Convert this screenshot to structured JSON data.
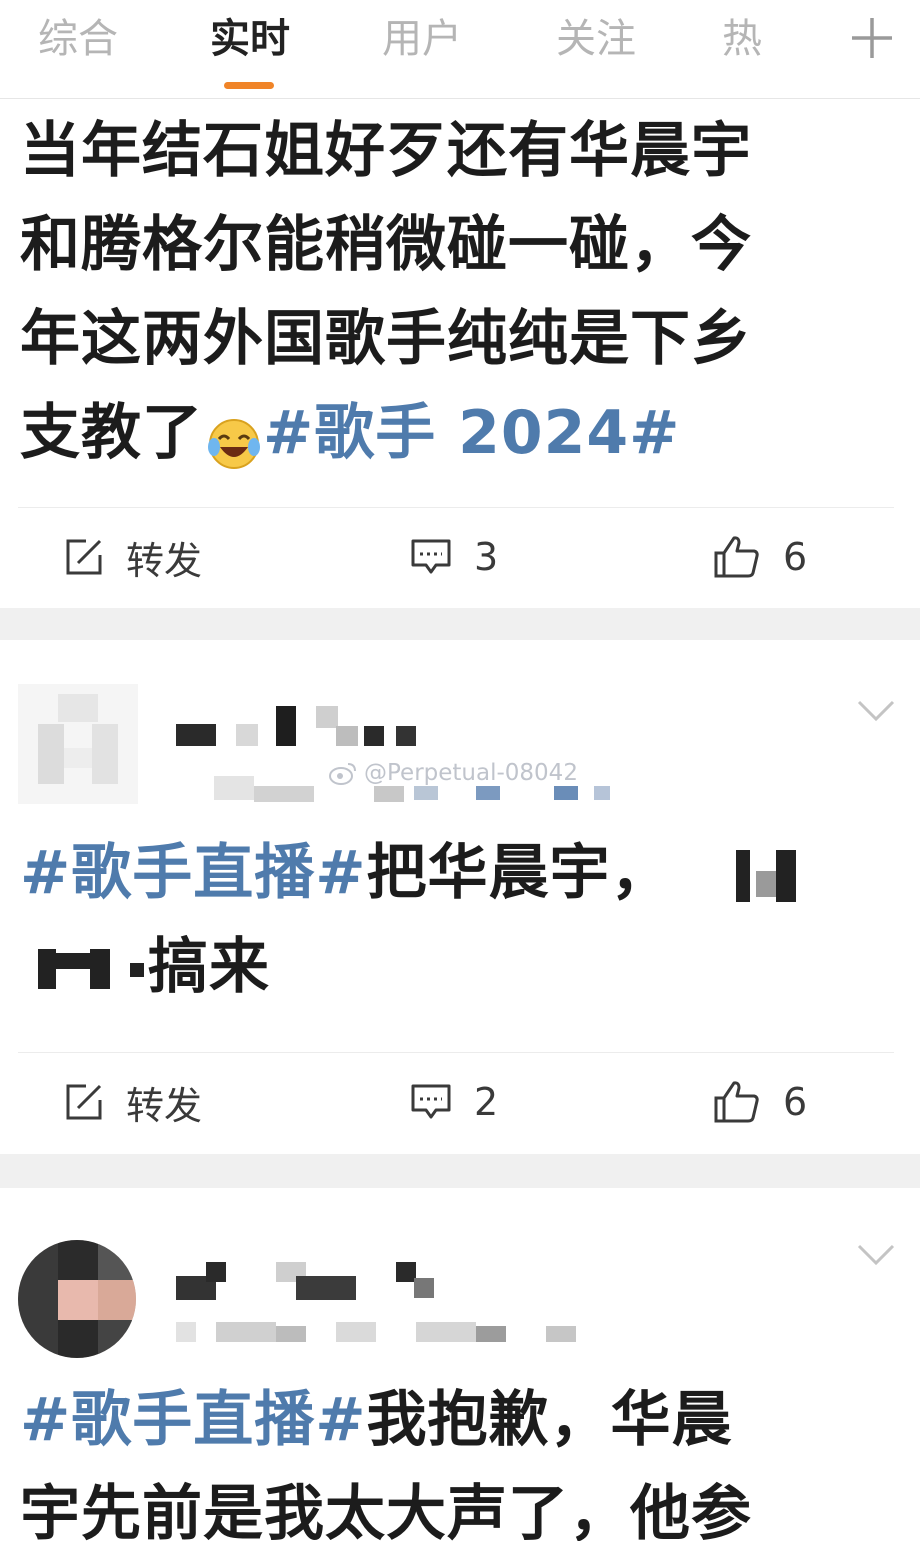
{
  "tabs": [
    {
      "label": "综合",
      "active": false
    },
    {
      "label": "实时",
      "active": true
    },
    {
      "label": "用户",
      "active": false
    },
    {
      "label": "关注",
      "active": false
    },
    {
      "label": "热门",
      "active": false
    }
  ],
  "tab_add_icon": "plus-icon",
  "accent_color": "#f08428",
  "hashtag_color": "#4f7bac",
  "posts": [
    {
      "lines": [
        "当年结石姐好歹还有华晨宇",
        "和腾格尔能稍微碰一碰，今",
        "年这两外国歌手纯纯是下乡",
        "支教了"
      ],
      "emoji": "laughing-crying-emoji",
      "hashtag": "#歌手 2024#",
      "actions": {
        "repost": "转发",
        "comments": "3",
        "likes": "6"
      }
    },
    {
      "hashtag": "#歌手直播#",
      "text_1": "把华晨宇，",
      "text_2": "搞来",
      "actions": {
        "repost": "转发",
        "comments": "2",
        "likes": "6"
      }
    },
    {
      "hashtag": "#歌手直播#",
      "text_1": "我抱歉，华晨",
      "text_2": "宇先前是我太大声了，他参"
    }
  ],
  "watermark": "@Perpetual-08042"
}
